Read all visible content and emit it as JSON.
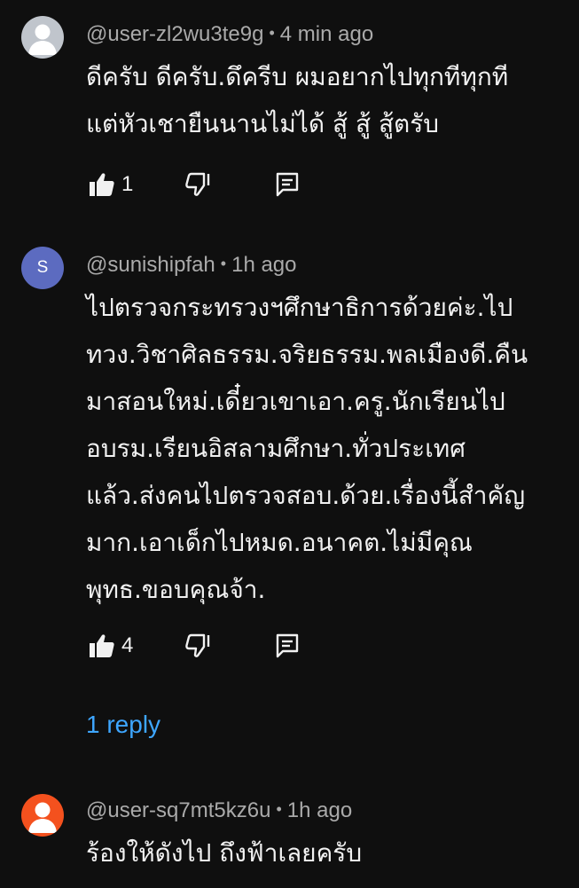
{
  "comments": [
    {
      "author": "@user-zl2wu3te9g",
      "separator": "•",
      "time": "4 min ago",
      "avatar_icon": "default-user-avatar",
      "avatar_color": "#c0c5cc",
      "lines": [
        "ดีครับ ดีครับ.ดึครีบ ผมอยากไปทุกทีทุกที",
        "แต่หัวเชายืนนานไม่ได้ สู้ สู้ สู้ตรับ"
      ],
      "likes": "1"
    },
    {
      "author": "@sunishipfah",
      "separator": "•",
      "time": "1h ago",
      "avatar_letter": "S",
      "avatar_color": "#5c6bc0",
      "lines": [
        "ไปตรวจกระทรวงฯศึกษาธิการด้วยค่ะ.ไป",
        "ทวง.วิชาศิลธรรม.จริยธรรม.พลเมืองดี.คืน",
        "มาสอนใหม่.เดี๋ยวเขาเอา.ครู.นักเรียนไป",
        "อบรม.เรียนอิสลามศึกษา.ทั่วประเทศ",
        "แล้ว.ส่งคนไปตรวจสอบ.ด้วย.เรื่องนี้สำคัญ",
        "มาก.เอาเด็กไปหมด.อนาคต.ไม่มีคุณ",
        "พุทธ.ขอบคุณจ้า."
      ],
      "likes": "4",
      "replies_label": "1 reply"
    },
    {
      "author": "@user-sq7mt5kz6u",
      "separator": "•",
      "time": "1h ago",
      "avatar_icon": "default-user-avatar",
      "avatar_color": "#f4511e",
      "lines": [
        "ร้องให้ดังไป ถึงฟ้าเลยครับ"
      ]
    }
  ],
  "icons": {
    "like": "thumbs-up-icon",
    "dislike": "thumbs-down-icon",
    "reply": "reply-comment-icon"
  },
  "colors": {
    "background": "#0f0f0f",
    "text": "#f1f1f1",
    "meta": "#aaaaaa",
    "link": "#3ea6ff"
  }
}
